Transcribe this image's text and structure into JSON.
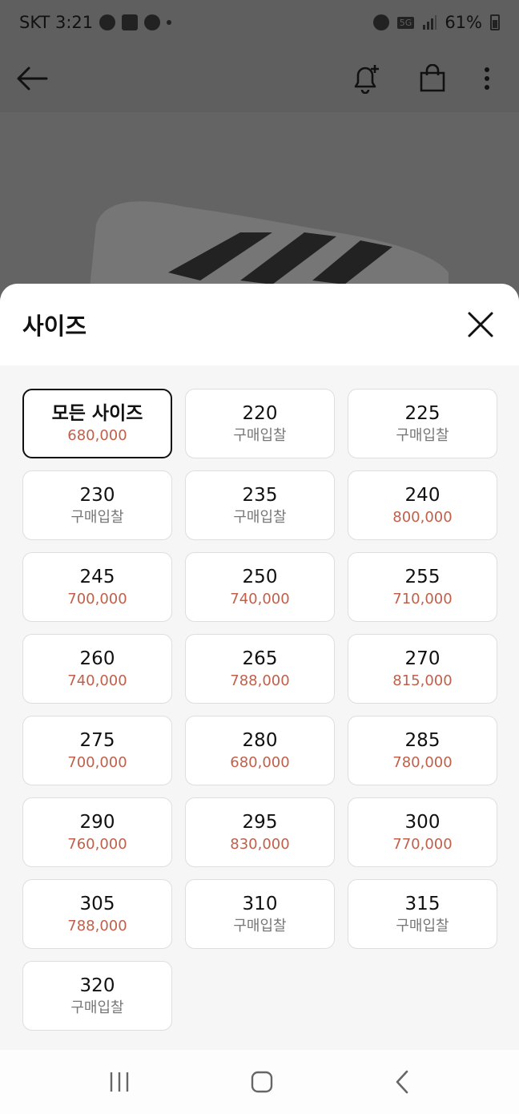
{
  "status_bar": {
    "carrier_time": "SKT 3:21",
    "talk_label": "TALK",
    "network": "5G",
    "battery": "61%"
  },
  "app_bar": {
    "back_icon": "arrow-left-icon",
    "alert_icon": "bell-plus-icon",
    "cart_icon": "shopping-bag-icon",
    "menu_icon": "more-vertical-icon"
  },
  "sheet": {
    "title": "사이즈",
    "close_icon": "close-icon",
    "options": [
      {
        "size": "모든 사이즈",
        "price": "680,000",
        "selected": true,
        "bid": false
      },
      {
        "size": "220",
        "price": "구매입찰",
        "selected": false,
        "bid": true
      },
      {
        "size": "225",
        "price": "구매입찰",
        "selected": false,
        "bid": true
      },
      {
        "size": "230",
        "price": "구매입찰",
        "selected": false,
        "bid": true
      },
      {
        "size": "235",
        "price": "구매입찰",
        "selected": false,
        "bid": true
      },
      {
        "size": "240",
        "price": "800,000",
        "selected": false,
        "bid": false
      },
      {
        "size": "245",
        "price": "700,000",
        "selected": false,
        "bid": false
      },
      {
        "size": "250",
        "price": "740,000",
        "selected": false,
        "bid": false
      },
      {
        "size": "255",
        "price": "710,000",
        "selected": false,
        "bid": false
      },
      {
        "size": "260",
        "price": "740,000",
        "selected": false,
        "bid": false
      },
      {
        "size": "265",
        "price": "788,000",
        "selected": false,
        "bid": false
      },
      {
        "size": "270",
        "price": "815,000",
        "selected": false,
        "bid": false
      },
      {
        "size": "275",
        "price": "700,000",
        "selected": false,
        "bid": false
      },
      {
        "size": "280",
        "price": "680,000",
        "selected": false,
        "bid": false
      },
      {
        "size": "285",
        "price": "780,000",
        "selected": false,
        "bid": false
      },
      {
        "size": "290",
        "price": "760,000",
        "selected": false,
        "bid": false
      },
      {
        "size": "295",
        "price": "830,000",
        "selected": false,
        "bid": false
      },
      {
        "size": "300",
        "price": "770,000",
        "selected": false,
        "bid": false
      },
      {
        "size": "305",
        "price": "788,000",
        "selected": false,
        "bid": false
      },
      {
        "size": "310",
        "price": "구매입찰",
        "selected": false,
        "bid": true
      },
      {
        "size": "315",
        "price": "구매입찰",
        "selected": false,
        "bid": true
      },
      {
        "size": "320",
        "price": "구매입찰",
        "selected": false,
        "bid": true
      }
    ]
  },
  "nav_bar": {
    "recents_icon": "recent-apps-icon",
    "home_icon": "home-icon",
    "back_icon": "nav-back-icon"
  },
  "colors": {
    "price": "#c0604a",
    "bid": "#777777",
    "overlay": "#5f5f5f"
  }
}
